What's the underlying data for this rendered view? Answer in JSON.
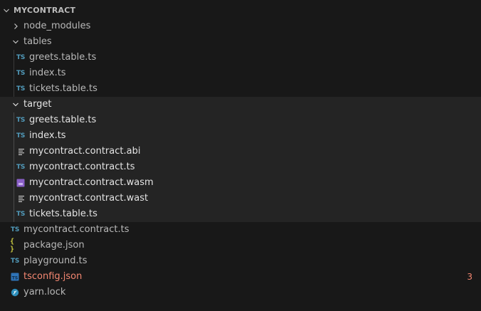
{
  "explorer": {
    "section_title": "MYCONTRACT",
    "items": [
      {
        "label": "node_modules",
        "kind": "folder",
        "state": "collapsed",
        "icon": "chevron-right-icon"
      },
      {
        "label": "tables",
        "kind": "folder",
        "state": "expanded",
        "icon": "chevron-down-icon"
      },
      {
        "label": "greets.table.ts",
        "kind": "file",
        "icon": "typescript-icon",
        "icon_text": "TS"
      },
      {
        "label": "index.ts",
        "kind": "file",
        "icon": "typescript-icon",
        "icon_text": "TS"
      },
      {
        "label": "tickets.table.ts",
        "kind": "file",
        "icon": "typescript-icon",
        "icon_text": "TS"
      },
      {
        "label": "target",
        "kind": "folder",
        "state": "expanded",
        "icon": "chevron-down-icon"
      },
      {
        "label": "greets.table.ts",
        "kind": "file",
        "icon": "typescript-icon",
        "icon_text": "TS"
      },
      {
        "label": "index.ts",
        "kind": "file",
        "icon": "typescript-icon",
        "icon_text": "TS"
      },
      {
        "label": "mycontract.contract.abi",
        "kind": "file",
        "icon": "text-lines-icon"
      },
      {
        "label": "mycontract.contract.ts",
        "kind": "file",
        "icon": "typescript-icon",
        "icon_text": "TS"
      },
      {
        "label": "mycontract.contract.wasm",
        "kind": "file",
        "icon": "webassembly-icon"
      },
      {
        "label": "mycontract.contract.wast",
        "kind": "file",
        "icon": "text-lines-icon"
      },
      {
        "label": "tickets.table.ts",
        "kind": "file",
        "icon": "typescript-icon",
        "icon_text": "TS"
      },
      {
        "label": "mycontract.contract.ts",
        "kind": "file",
        "icon": "typescript-icon",
        "icon_text": "TS"
      },
      {
        "label": "package.json",
        "kind": "file",
        "icon": "json-icon",
        "icon_text": "{ }"
      },
      {
        "label": "playground.ts",
        "kind": "file",
        "icon": "typescript-icon",
        "icon_text": "TS"
      },
      {
        "label": "tsconfig.json",
        "kind": "file",
        "icon": "tsconfig-icon",
        "icon_text": "TS",
        "status": "error",
        "badge": "3"
      },
      {
        "label": "yarn.lock",
        "kind": "file",
        "icon": "yarn-icon"
      }
    ]
  },
  "colors": {
    "background": "#181818",
    "highlight_background": "#242424",
    "typescript": "#519aba",
    "json": "#cbcb41",
    "error": "#f48771",
    "wasm": "#8a5fc7",
    "yarn": "#2c8ebb"
  }
}
